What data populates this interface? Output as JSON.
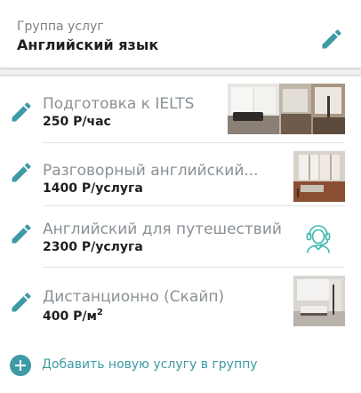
{
  "header": {
    "caption": "Группа услуг",
    "title": "Английский язык"
  },
  "services": [
    {
      "name": "Подготовка к IELTS",
      "price": "250 Р/час",
      "thumb": "interior-photo"
    },
    {
      "name": "Разговорный английский...",
      "price": "1400 Р/услуга",
      "thumb": "interior-photo"
    },
    {
      "name": "Английский для путешествий",
      "price": "2300 Р/услуга",
      "thumb": "support-agent-icon"
    },
    {
      "name": "Дистанционно (Скайп)",
      "price_main": "400 Р/м",
      "price_sup": "2",
      "thumb": "interior-photo"
    }
  ],
  "add_label": "Добавить новую услугу в группу",
  "colors": {
    "accent": "#3e9aa5",
    "text_primary": "#1f1f1f",
    "text_secondary": "#8a9196",
    "background": "#f1f1f1"
  }
}
